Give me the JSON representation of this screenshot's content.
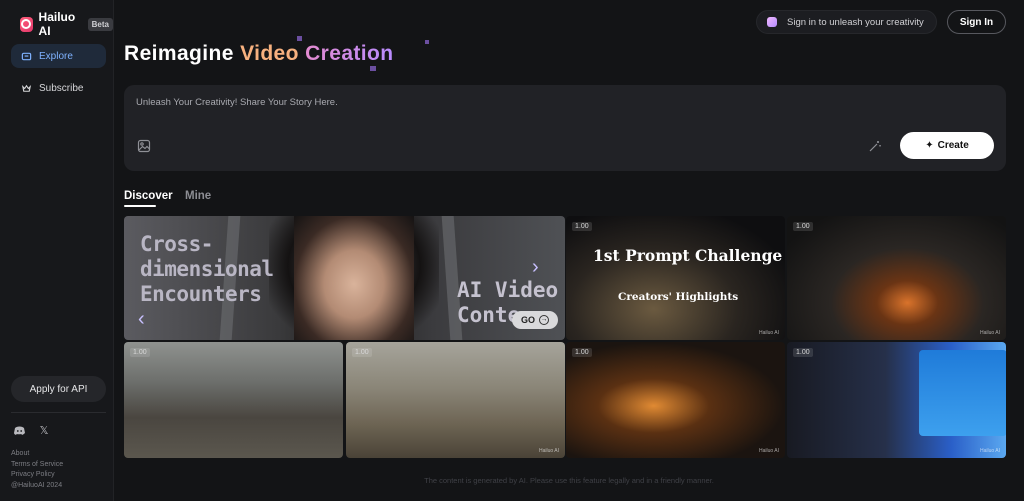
{
  "brand": {
    "name": "Hailuo AI",
    "badge": "Beta"
  },
  "sidebar": {
    "items": [
      {
        "label": "Explore",
        "icon": "explore-icon",
        "active": true
      },
      {
        "label": "Subscribe",
        "icon": "subscribe-icon",
        "active": false
      }
    ],
    "api_button": "Apply for API",
    "social": [
      "discord-icon",
      "x-icon"
    ],
    "footer_links": [
      "About",
      "Terms of Service",
      "Privacy Policy",
      "@HailuoAI 2024"
    ]
  },
  "header": {
    "signin_prompt": "Sign in to unleash your creativity",
    "signin_button": "Sign In"
  },
  "hero": {
    "word1": "Reimagine",
    "word2": "Video",
    "word3": "Creation"
  },
  "prompt": {
    "placeholder": "Unleash Your Creativity! Share Your Story Here.",
    "create_button": "Create"
  },
  "tabs": [
    {
      "label": "Discover",
      "active": true
    },
    {
      "label": "Mine",
      "active": false
    }
  ],
  "cards": {
    "feature": {
      "title": "Cross-\ndimensional\nEncounters",
      "subtitle": "AI Video\nConte",
      "go_label": "GO"
    },
    "prompt_challenge": {
      "badge": "1.00",
      "title": "1st Prompt Challenge",
      "subtitle": "Creators' Highlights"
    },
    "fire": {
      "badge": "1.00"
    },
    "alien": {
      "badge": "1.00"
    },
    "horse": {
      "badge": "1.00"
    },
    "city": {
      "badge": "1.00"
    },
    "game": {
      "badge": "1.00"
    }
  },
  "footer_note": "The content is generated by AI. Please use this feature legally and in a friendly manner.",
  "colors": {
    "accent": "#7fb2ff",
    "brand": "#e2376b",
    "video": "#f7b17f",
    "creation": "#c08cf0"
  }
}
